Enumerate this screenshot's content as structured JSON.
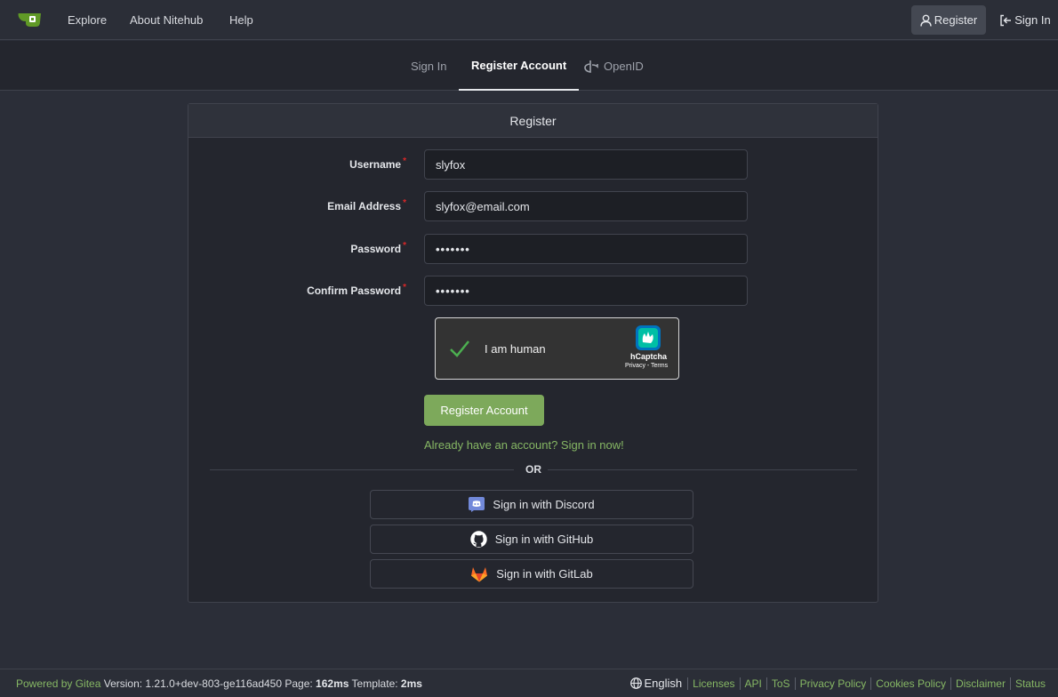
{
  "nav": {
    "items": [
      "Explore",
      "About Nitehub",
      "Help"
    ],
    "register_label": "Register",
    "signin_label": "Sign In"
  },
  "tabs": {
    "signin": "Sign In",
    "register": "Register Account",
    "openid": "OpenID"
  },
  "form": {
    "title": "Register",
    "username_label": "Username",
    "username_value": "slyfox",
    "email_label": "Email Address",
    "email_value": "slyfox@email.com",
    "password_label": "Password",
    "password_value": "•••••••",
    "confirm_label": "Confirm Password",
    "confirm_value": "•••••••",
    "required_mark": "*",
    "submit_label": "Register Account",
    "already_text": "Already have an account? Sign in now!"
  },
  "captcha": {
    "text": "I am human",
    "brand": "hCaptcha",
    "terms": "Privacy - Terms"
  },
  "divider": {
    "text": "OR"
  },
  "oauth": {
    "discord": "Sign in with Discord",
    "github": "Sign in with GitHub",
    "gitlab": "Sign in with GitLab"
  },
  "footer": {
    "powered": "Powered by Gitea",
    "version_label": "Version: 1.21.0+dev-803-ge116ad450 Page:",
    "page_time": "162ms",
    "template_label": "Template:",
    "template_time": "2ms",
    "language": "English",
    "links": [
      "Licenses",
      "API",
      "ToS",
      "Privacy Policy",
      "Cookies Policy",
      "Disclaimer",
      "Status"
    ]
  },
  "colors": {
    "accent_green": "#86b764",
    "button_green": "#7da95b",
    "required_red": "#db2828",
    "background": "#2b2e38",
    "panel": "#24262e"
  },
  "icons": [
    "gitea-logo-icon",
    "user-icon",
    "sign-in-icon",
    "openid-icon",
    "checkmark-icon",
    "hcaptcha-logo-icon",
    "discord-icon",
    "github-icon",
    "gitlab-icon",
    "globe-icon"
  ]
}
